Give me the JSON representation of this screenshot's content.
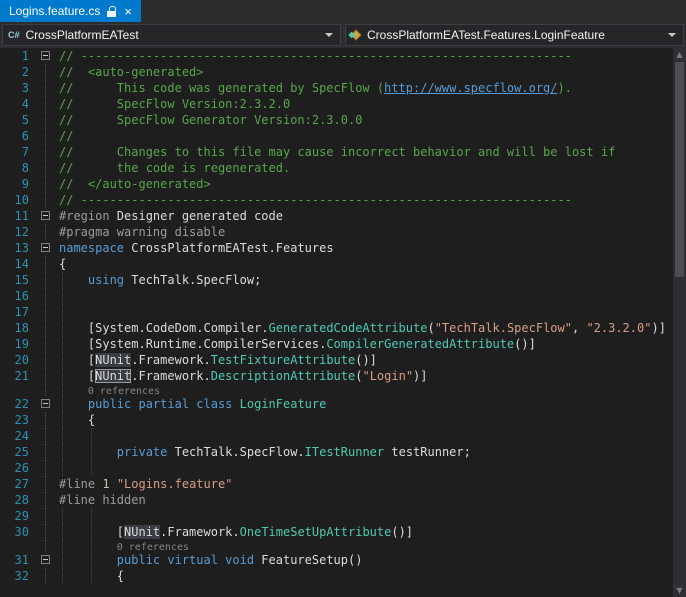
{
  "colors": {
    "active_tab": "#007ACC",
    "editor_bg": "#1E1E1E",
    "line_number": "#2B91AF",
    "comment": "#57A64A",
    "keyword": "#569CD6",
    "type": "#4EC9B0",
    "string": "#D69D85",
    "preprocessor": "#9B9B9B",
    "plain": "#DCDCDC"
  },
  "tab": {
    "title": "Logins.feature.cs",
    "close_glyph": "×"
  },
  "navbar": {
    "project_icon_label": "C#",
    "project": "CrossPlatformEATest",
    "member": "CrossPlatformEATest.Features.LoginFeature"
  },
  "editor": {
    "codelens_label": "0 references",
    "rows": [
      {
        "n": 1,
        "fold": true,
        "g": [],
        "seg": [
          {
            "t": "// --------------------------------------------------------------------",
            "s": "c"
          }
        ]
      },
      {
        "n": 2,
        "g": [],
        "seg": [
          {
            "t": "//  <auto-generated>",
            "s": "c"
          }
        ]
      },
      {
        "n": 3,
        "g": [],
        "seg": [
          {
            "t": "//      This code was generated by SpecFlow (",
            "s": "c"
          },
          {
            "t": "http://www.specflow.org/",
            "s": "lnk"
          },
          {
            "t": ").",
            "s": "c"
          }
        ]
      },
      {
        "n": 4,
        "g": [],
        "seg": [
          {
            "t": "//      SpecFlow Version:2.3.2.0",
            "s": "c"
          }
        ]
      },
      {
        "n": 5,
        "g": [],
        "seg": [
          {
            "t": "//      SpecFlow Generator Version:2.3.0.0",
            "s": "c"
          }
        ]
      },
      {
        "n": 6,
        "g": [],
        "seg": [
          {
            "t": "//",
            "s": "c"
          }
        ]
      },
      {
        "n": 7,
        "g": [],
        "seg": [
          {
            "t": "//      Changes to this file may cause incorrect behavior and will be lost if",
            "s": "c"
          }
        ]
      },
      {
        "n": 8,
        "g": [],
        "seg": [
          {
            "t": "//      the code is regenerated.",
            "s": "c"
          }
        ]
      },
      {
        "n": 9,
        "g": [],
        "seg": [
          {
            "t": "//  </auto-generated>",
            "s": "c"
          }
        ]
      },
      {
        "n": 10,
        "g": [],
        "seg": [
          {
            "t": "// --------------------------------------------------------------------",
            "s": "c"
          }
        ]
      },
      {
        "n": 11,
        "fold": true,
        "g": [],
        "seg": [
          {
            "t": "#region",
            "s": "pp"
          },
          {
            "t": " Designer generated code",
            "s": "p"
          }
        ]
      },
      {
        "n": 12,
        "g": [],
        "seg": [
          {
            "t": "#pragma warning disable",
            "s": "pp"
          }
        ]
      },
      {
        "n": 13,
        "fold": true,
        "g": [],
        "seg": [
          {
            "t": "namespace",
            "s": "k"
          },
          {
            "t": " CrossPlatformEATest.Features",
            "s": "p"
          }
        ]
      },
      {
        "n": 14,
        "g": [],
        "seg": [
          {
            "t": "{",
            "s": "p"
          }
        ]
      },
      {
        "n": 15,
        "g": [
          0
        ],
        "seg": [
          {
            "t": "    ",
            "s": "p"
          },
          {
            "t": "using",
            "s": "k"
          },
          {
            "t": " TechTalk.SpecFlow;",
            "s": "p"
          }
        ]
      },
      {
        "n": 16,
        "g": [
          0
        ],
        "seg": []
      },
      {
        "n": 17,
        "g": [
          0
        ],
        "seg": []
      },
      {
        "n": 18,
        "g": [
          0
        ],
        "seg": [
          {
            "t": "    [System.CodeDom.Compiler.",
            "s": "p"
          },
          {
            "t": "GeneratedCodeAttribute",
            "s": "t"
          },
          {
            "t": "(",
            "s": "p"
          },
          {
            "t": "\"TechTalk.SpecFlow\"",
            "s": "s"
          },
          {
            "t": ", ",
            "s": "p"
          },
          {
            "t": "\"2.3.2.0\"",
            "s": "s"
          },
          {
            "t": ")]",
            "s": "p"
          }
        ]
      },
      {
        "n": 19,
        "g": [
          0
        ],
        "seg": [
          {
            "t": "    [System.Runtime.CompilerServices.",
            "s": "p"
          },
          {
            "t": "CompilerGeneratedAttribute",
            "s": "t"
          },
          {
            "t": "()]",
            "s": "p"
          }
        ]
      },
      {
        "n": 20,
        "g": [
          0
        ],
        "seg": [
          {
            "t": "    [",
            "s": "p"
          },
          {
            "t": "NUnit",
            "s": "hl"
          },
          {
            "t": ".Framework.",
            "s": "p"
          },
          {
            "t": "TestFixtureAttribute",
            "s": "t"
          },
          {
            "t": "()]",
            "s": "p"
          }
        ]
      },
      {
        "n": 21,
        "g": [
          0
        ],
        "seg": [
          {
            "t": "    [",
            "s": "p"
          },
          {
            "t": "NUnit",
            "s": "cr"
          },
          {
            "t": ".Framework.",
            "s": "p"
          },
          {
            "t": "DescriptionAttribute",
            "s": "t"
          },
          {
            "t": "(",
            "s": "p"
          },
          {
            "t": "\"Login\"",
            "s": "s"
          },
          {
            "t": ")]",
            "s": "p"
          }
        ]
      },
      {
        "lens": "0 references",
        "indent": 4,
        "g": [
          0
        ]
      },
      {
        "n": 22,
        "fold": true,
        "g": [
          0
        ],
        "seg": [
          {
            "t": "    ",
            "s": "p"
          },
          {
            "t": "public partial class",
            "s": "k"
          },
          {
            "t": " ",
            "s": "p"
          },
          {
            "t": "LoginFeature",
            "s": "t"
          }
        ]
      },
      {
        "n": 23,
        "g": [
          0
        ],
        "seg": [
          {
            "t": "    {",
            "s": "p"
          }
        ]
      },
      {
        "n": 24,
        "g": [
          0,
          4
        ],
        "seg": []
      },
      {
        "n": 25,
        "g": [
          0,
          4
        ],
        "seg": [
          {
            "t": "        ",
            "s": "p"
          },
          {
            "t": "private",
            "s": "k"
          },
          {
            "t": " TechTalk.SpecFlow.",
            "s": "p"
          },
          {
            "t": "ITestRunner",
            "s": "t"
          },
          {
            "t": " testRunner;",
            "s": "p"
          }
        ]
      },
      {
        "n": 26,
        "g": [
          0,
          4
        ],
        "seg": []
      },
      {
        "n": 27,
        "g": [],
        "seg": [
          {
            "t": "#line ",
            "s": "pp"
          },
          {
            "t": "1",
            "s": "n"
          },
          {
            "t": " ",
            "s": "p"
          },
          {
            "t": "\"Logins.feature\"",
            "s": "s"
          }
        ]
      },
      {
        "n": 28,
        "g": [],
        "seg": [
          {
            "t": "#line hidden",
            "s": "pp"
          }
        ]
      },
      {
        "n": 29,
        "g": [
          0,
          4
        ],
        "seg": []
      },
      {
        "n": 30,
        "g": [
          0,
          4
        ],
        "seg": [
          {
            "t": "        [",
            "s": "p"
          },
          {
            "t": "NUnit",
            "s": "hl"
          },
          {
            "t": ".Framework.",
            "s": "p"
          },
          {
            "t": "OneTimeSetUpAttribute",
            "s": "t"
          },
          {
            "t": "()]",
            "s": "p"
          }
        ]
      },
      {
        "lens": "0 references",
        "indent": 8,
        "g": [
          0,
          4
        ]
      },
      {
        "n": 31,
        "fold": true,
        "g": [
          0,
          4
        ],
        "seg": [
          {
            "t": "        ",
            "s": "p"
          },
          {
            "t": "public virtual void",
            "s": "k"
          },
          {
            "t": " FeatureSetup()",
            "s": "p"
          }
        ]
      },
      {
        "n": 32,
        "g": [
          0,
          4
        ],
        "seg": [
          {
            "t": "        {",
            "s": "p"
          }
        ]
      }
    ]
  }
}
